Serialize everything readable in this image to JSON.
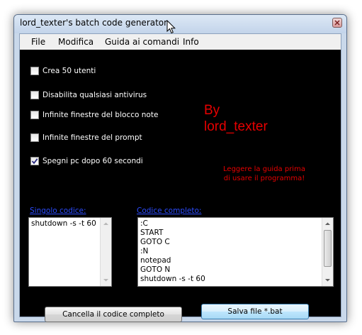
{
  "window": {
    "title": "lord_texter's batch code generator"
  },
  "menu": {
    "items": [
      "File",
      "Modifica",
      "Guida ai comandi",
      "Info"
    ]
  },
  "options": [
    {
      "label": "Crea 50 utenti",
      "checked": false
    },
    {
      "label": "Disabilita qualsiasi antivirus",
      "checked": false
    },
    {
      "label": "Infinite finestre del blocco note",
      "checked": false
    },
    {
      "label": "Infinite finestre del prompt",
      "checked": false
    },
    {
      "label": "Spegni pc dopo 60 secondi",
      "checked": true
    }
  ],
  "credit": {
    "line1": "By",
    "line2": "lord_texter"
  },
  "warning": {
    "line1": "Leggere la guida prima",
    "line2": "di usare il programma!"
  },
  "single_code": {
    "label": "Singolo codice:",
    "content": "shutdown -s -t 60"
  },
  "full_code": {
    "label": "Codice completo:",
    "lines": [
      ":C",
      "START",
      "GOTO C",
      ":N",
      "notepad",
      "GOTO N",
      "shutdown -s -t 60"
    ]
  },
  "buttons": {
    "clear_label": "Cancella il codice completo",
    "save_label": "Salva file *.bat"
  },
  "colors": {
    "background": "#000000",
    "credit_text": "#e60000",
    "link_text": "#2b4cff"
  }
}
